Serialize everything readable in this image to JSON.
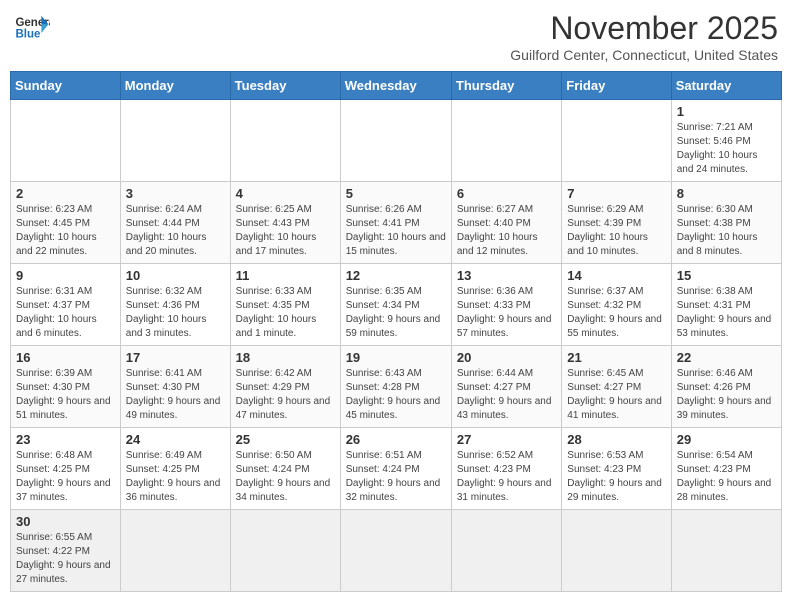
{
  "header": {
    "logo_general": "General",
    "logo_blue": "Blue",
    "month_title": "November 2025",
    "location": "Guilford Center, Connecticut, United States"
  },
  "days_of_week": [
    "Sunday",
    "Monday",
    "Tuesday",
    "Wednesday",
    "Thursday",
    "Friday",
    "Saturday"
  ],
  "weeks": [
    [
      {
        "day": "",
        "info": ""
      },
      {
        "day": "",
        "info": ""
      },
      {
        "day": "",
        "info": ""
      },
      {
        "day": "",
        "info": ""
      },
      {
        "day": "",
        "info": ""
      },
      {
        "day": "",
        "info": ""
      },
      {
        "day": "1",
        "info": "Sunrise: 7:21 AM\nSunset: 5:46 PM\nDaylight: 10 hours and 24 minutes."
      }
    ],
    [
      {
        "day": "2",
        "info": "Sunrise: 6:23 AM\nSunset: 4:45 PM\nDaylight: 10 hours and 22 minutes."
      },
      {
        "day": "3",
        "info": "Sunrise: 6:24 AM\nSunset: 4:44 PM\nDaylight: 10 hours and 20 minutes."
      },
      {
        "day": "4",
        "info": "Sunrise: 6:25 AM\nSunset: 4:43 PM\nDaylight: 10 hours and 17 minutes."
      },
      {
        "day": "5",
        "info": "Sunrise: 6:26 AM\nSunset: 4:41 PM\nDaylight: 10 hours and 15 minutes."
      },
      {
        "day": "6",
        "info": "Sunrise: 6:27 AM\nSunset: 4:40 PM\nDaylight: 10 hours and 12 minutes."
      },
      {
        "day": "7",
        "info": "Sunrise: 6:29 AM\nSunset: 4:39 PM\nDaylight: 10 hours and 10 minutes."
      },
      {
        "day": "8",
        "info": "Sunrise: 6:30 AM\nSunset: 4:38 PM\nDaylight: 10 hours and 8 minutes."
      }
    ],
    [
      {
        "day": "9",
        "info": "Sunrise: 6:31 AM\nSunset: 4:37 PM\nDaylight: 10 hours and 6 minutes."
      },
      {
        "day": "10",
        "info": "Sunrise: 6:32 AM\nSunset: 4:36 PM\nDaylight: 10 hours and 3 minutes."
      },
      {
        "day": "11",
        "info": "Sunrise: 6:33 AM\nSunset: 4:35 PM\nDaylight: 10 hours and 1 minute."
      },
      {
        "day": "12",
        "info": "Sunrise: 6:35 AM\nSunset: 4:34 PM\nDaylight: 9 hours and 59 minutes."
      },
      {
        "day": "13",
        "info": "Sunrise: 6:36 AM\nSunset: 4:33 PM\nDaylight: 9 hours and 57 minutes."
      },
      {
        "day": "14",
        "info": "Sunrise: 6:37 AM\nSunset: 4:32 PM\nDaylight: 9 hours and 55 minutes."
      },
      {
        "day": "15",
        "info": "Sunrise: 6:38 AM\nSunset: 4:31 PM\nDaylight: 9 hours and 53 minutes."
      }
    ],
    [
      {
        "day": "16",
        "info": "Sunrise: 6:39 AM\nSunset: 4:30 PM\nDaylight: 9 hours and 51 minutes."
      },
      {
        "day": "17",
        "info": "Sunrise: 6:41 AM\nSunset: 4:30 PM\nDaylight: 9 hours and 49 minutes."
      },
      {
        "day": "18",
        "info": "Sunrise: 6:42 AM\nSunset: 4:29 PM\nDaylight: 9 hours and 47 minutes."
      },
      {
        "day": "19",
        "info": "Sunrise: 6:43 AM\nSunset: 4:28 PM\nDaylight: 9 hours and 45 minutes."
      },
      {
        "day": "20",
        "info": "Sunrise: 6:44 AM\nSunset: 4:27 PM\nDaylight: 9 hours and 43 minutes."
      },
      {
        "day": "21",
        "info": "Sunrise: 6:45 AM\nSunset: 4:27 PM\nDaylight: 9 hours and 41 minutes."
      },
      {
        "day": "22",
        "info": "Sunrise: 6:46 AM\nSunset: 4:26 PM\nDaylight: 9 hours and 39 minutes."
      }
    ],
    [
      {
        "day": "23",
        "info": "Sunrise: 6:48 AM\nSunset: 4:25 PM\nDaylight: 9 hours and 37 minutes."
      },
      {
        "day": "24",
        "info": "Sunrise: 6:49 AM\nSunset: 4:25 PM\nDaylight: 9 hours and 36 minutes."
      },
      {
        "day": "25",
        "info": "Sunrise: 6:50 AM\nSunset: 4:24 PM\nDaylight: 9 hours and 34 minutes."
      },
      {
        "day": "26",
        "info": "Sunrise: 6:51 AM\nSunset: 4:24 PM\nDaylight: 9 hours and 32 minutes."
      },
      {
        "day": "27",
        "info": "Sunrise: 6:52 AM\nSunset: 4:23 PM\nDaylight: 9 hours and 31 minutes."
      },
      {
        "day": "28",
        "info": "Sunrise: 6:53 AM\nSunset: 4:23 PM\nDaylight: 9 hours and 29 minutes."
      },
      {
        "day": "29",
        "info": "Sunrise: 6:54 AM\nSunset: 4:23 PM\nDaylight: 9 hours and 28 minutes."
      }
    ],
    [
      {
        "day": "30",
        "info": "Sunrise: 6:55 AM\nSunset: 4:22 PM\nDaylight: 9 hours and 27 minutes."
      },
      {
        "day": "",
        "info": ""
      },
      {
        "day": "",
        "info": ""
      },
      {
        "day": "",
        "info": ""
      },
      {
        "day": "",
        "info": ""
      },
      {
        "day": "",
        "info": ""
      },
      {
        "day": "",
        "info": ""
      }
    ]
  ]
}
